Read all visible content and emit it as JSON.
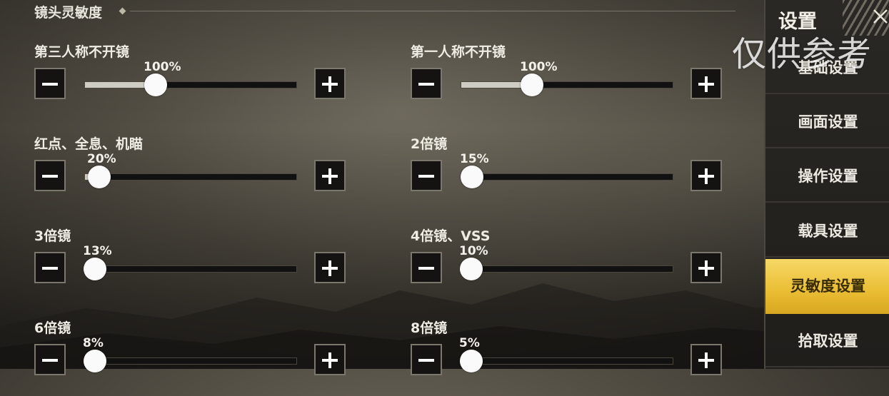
{
  "section": {
    "title": "镜头灵敏度"
  },
  "settings": [
    {
      "label": "第三人称不开镜",
      "value": 100,
      "value_text": "100%"
    },
    {
      "label": "第一人称不开镜",
      "value": 100,
      "value_text": "100%"
    },
    {
      "label": "红点、全息、机瞄",
      "value": 20,
      "value_text": "20%"
    },
    {
      "label": "2倍镜",
      "value": 15,
      "value_text": "15%"
    },
    {
      "label": "3倍镜",
      "value": 13,
      "value_text": "13%"
    },
    {
      "label": "4倍镜、VSS",
      "value": 10,
      "value_text": "10%"
    },
    {
      "label": "6倍镜",
      "value": 8,
      "value_text": "8%"
    },
    {
      "label": "8倍镜",
      "value": 5,
      "value_text": "5%"
    }
  ],
  "slider": {
    "min": 0,
    "max": 300
  },
  "menu": {
    "title": "设置",
    "items": [
      {
        "label": "基础设置",
        "active": false
      },
      {
        "label": "画面设置",
        "active": false
      },
      {
        "label": "操作设置",
        "active": false
      },
      {
        "label": "载具设置",
        "active": false
      },
      {
        "label": "灵敏度设置",
        "active": true
      },
      {
        "label": "拾取设置",
        "active": false
      }
    ]
  },
  "watermark": "仅供参考",
  "colors": {
    "accent": "#e9bd33",
    "slider_fill": "#cfccc4",
    "track": "#111111"
  }
}
